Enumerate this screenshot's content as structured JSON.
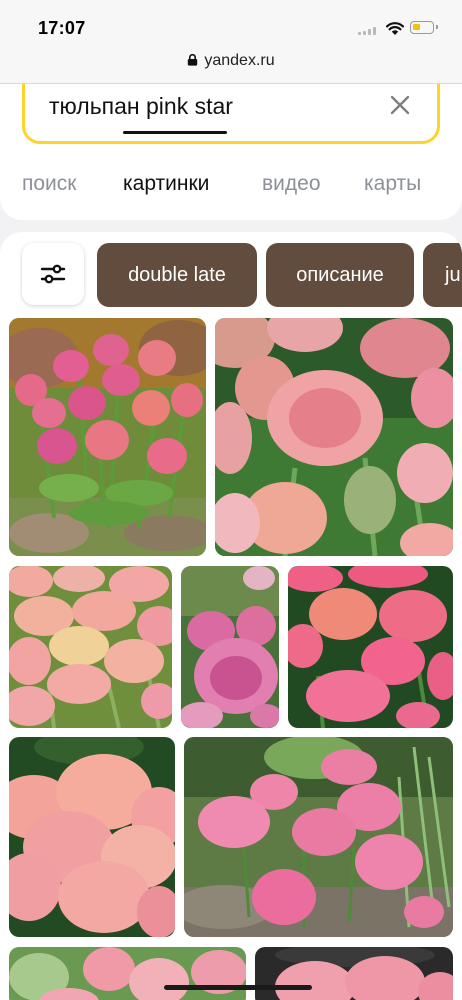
{
  "status_bar": {
    "time": "17:07"
  },
  "browser": {
    "url": "yandex.ru"
  },
  "search": {
    "query": "тюльпан pink star"
  },
  "tabs": [
    {
      "label": "поиск",
      "active": false
    },
    {
      "label": "картинки",
      "active": true
    },
    {
      "label": "видео",
      "active": false
    },
    {
      "label": "карты",
      "active": false
    }
  ],
  "chips": [
    "double late",
    "описание",
    "ju"
  ],
  "colors": {
    "accent_yellow": "#fed42b",
    "chip_bg": "#614c3d",
    "tab_inactive": "#8d9099"
  },
  "icons": [
    "lock-icon",
    "close-icon",
    "filter-sliders-icon",
    "wifi-icon",
    "battery-icon",
    "signal-icon"
  ],
  "results_count_visible": 9
}
